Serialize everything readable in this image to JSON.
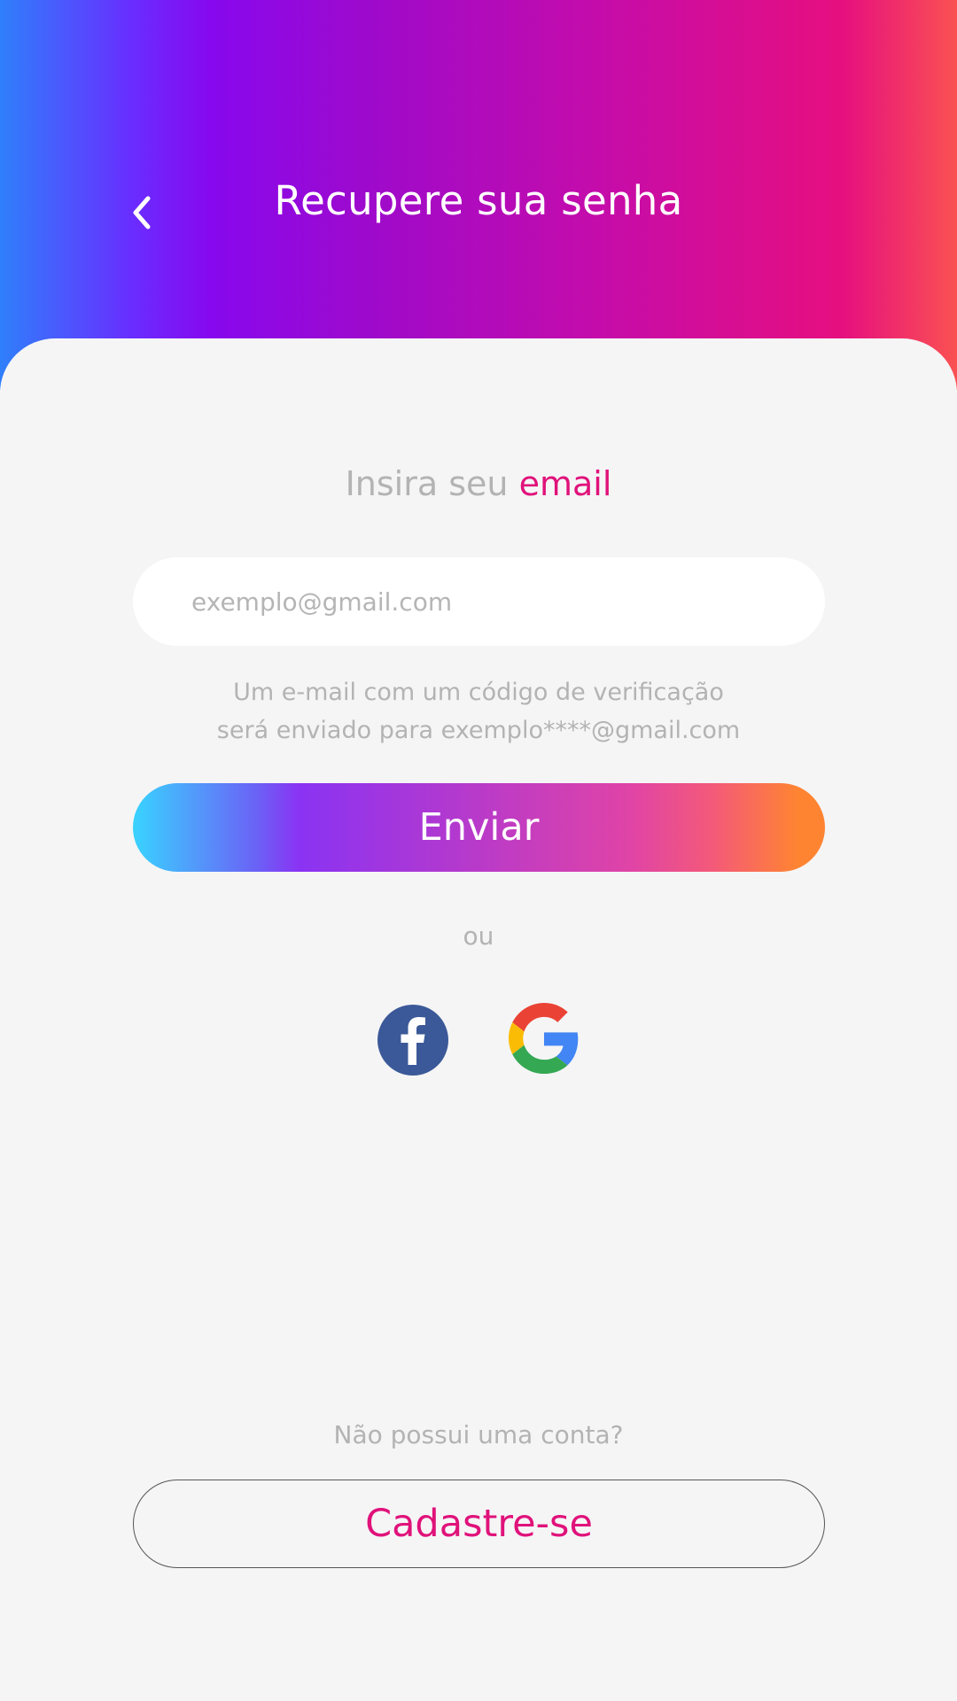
{
  "header": {
    "title": "Recupere sua senha",
    "back_icon": "chevron-left-icon"
  },
  "form": {
    "prompt_prefix": "Insira seu",
    "prompt_accent": "email",
    "email_placeholder": "exemplo@gmail.com",
    "email_value": "",
    "helper_line1": "Um e-mail com um código de verificação",
    "helper_line2": "será enviado para exemplo****@gmail.com",
    "send_label": "Enviar"
  },
  "social": {
    "divider_text": "ou",
    "providers": [
      "facebook-icon",
      "google-icon"
    ]
  },
  "footer": {
    "no_account_text": "Não possui uma conta?",
    "signup_label": "Cadastre-se"
  },
  "colors": {
    "accent": "#e0127a",
    "facebook": "#3b5998",
    "muted_text": "#b3b3b3"
  }
}
